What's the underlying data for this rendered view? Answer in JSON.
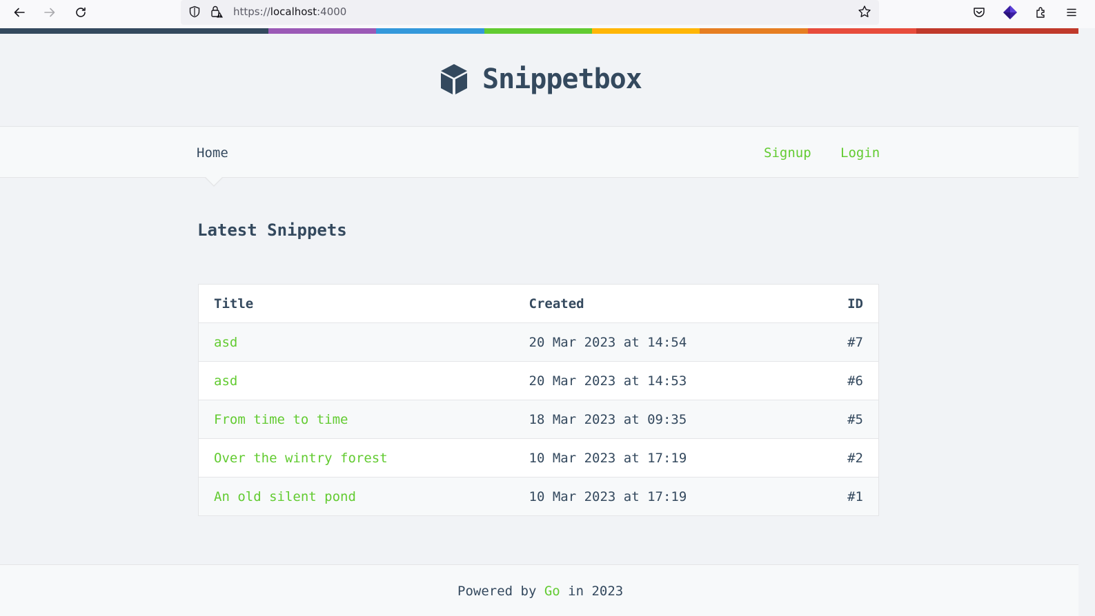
{
  "browser": {
    "url_scheme": "https://",
    "url_host": "localhost",
    "url_port": ":4000"
  },
  "rainbow_colors": [
    "#34495e",
    "#9b59b6",
    "#3498db",
    "#62cb31",
    "#ffb606",
    "#e67e22",
    "#e74c3c",
    "#c0392b"
  ],
  "header": {
    "site_name": "Snippetbox",
    "logo_icon": "cube-icon"
  },
  "nav": {
    "home": "Home",
    "signup": "Signup",
    "login": "Login"
  },
  "main": {
    "title": "Latest Snippets",
    "table": {
      "columns": [
        "Title",
        "Created",
        "ID"
      ],
      "rows": [
        {
          "title": "asd",
          "created": "20 Mar 2023 at 14:54",
          "id": "#7"
        },
        {
          "title": "asd",
          "created": "20 Mar 2023 at 14:53",
          "id": "#6"
        },
        {
          "title": "From time to time",
          "created": "18 Mar 2023 at 09:35",
          "id": "#5"
        },
        {
          "title": "Over the wintry forest",
          "created": "10 Mar 2023 at 17:19",
          "id": "#2"
        },
        {
          "title": "An old silent pond",
          "created": "10 Mar 2023 at 17:19",
          "id": "#1"
        }
      ]
    }
  },
  "footer": {
    "prefix": "Powered by ",
    "link": "Go",
    "suffix": " in 2023"
  },
  "colors": {
    "accent": "#62cb31",
    "text": "#34495e",
    "background": "#f1f3f6"
  }
}
